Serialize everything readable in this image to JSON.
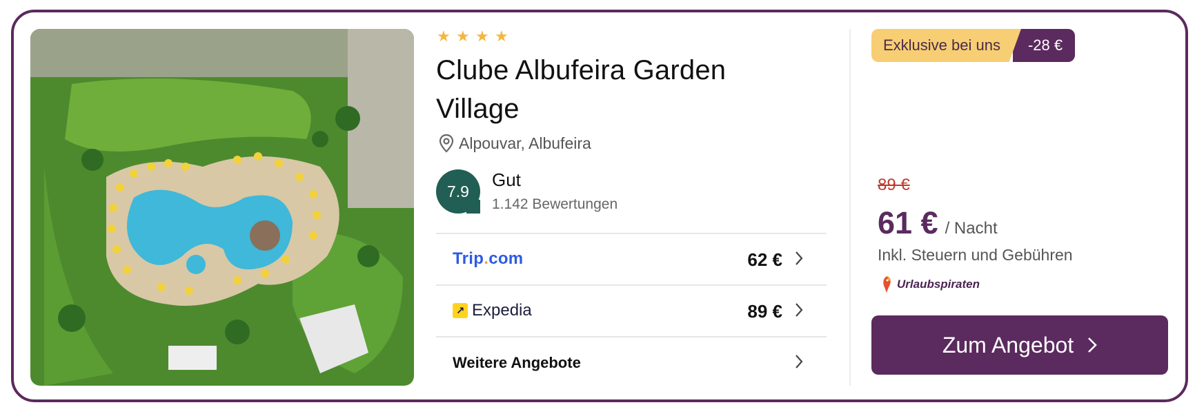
{
  "hotel": {
    "stars": 4,
    "name": "Clube Albufeira Garden Village",
    "location": "Alpouvar, Albufeira",
    "rating_score": "7.9",
    "rating_word": "Gut",
    "reviews": "1.142 Bewertungen"
  },
  "offers": [
    {
      "provider": "Trip.com",
      "price": "62 €"
    },
    {
      "provider": "Expedia",
      "price": "89 €"
    }
  ],
  "more_offers_label": "Weitere Angebote",
  "deal": {
    "badge_label": "Exklusive bei uns",
    "discount": "-28 €",
    "old_price": "89 €",
    "price": "61 €",
    "per_night": "/ Nacht",
    "tax_note": "Inkl. Steuern und Gebühren",
    "partner": "Urlaubspiraten",
    "cta_label": "Zum Angebot"
  },
  "colors": {
    "brand": "#5b2a5e",
    "badge_yellow": "#f7ce73",
    "rating_green": "#215e53",
    "star": "#f4b63f",
    "old_price_red": "#c0392b"
  }
}
